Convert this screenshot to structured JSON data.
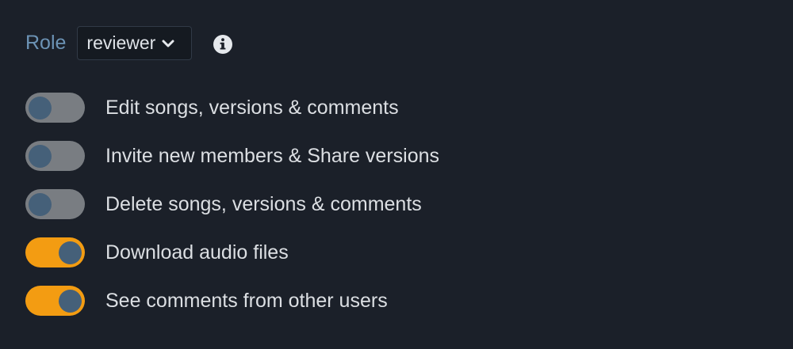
{
  "role": {
    "label": "Role",
    "selected": "reviewer"
  },
  "icons": {
    "info": "info-icon",
    "chevron": "chevron-down-icon"
  },
  "colors": {
    "background": "#1b2029",
    "accent_on": "#f39c12",
    "toggle_off": "#797d82",
    "knob": "#456079",
    "role_label": "#6c93b5"
  },
  "permissions": [
    {
      "label": "Edit songs, versions & comments",
      "enabled": false
    },
    {
      "label": "Invite new members & Share versions",
      "enabled": false
    },
    {
      "label": "Delete songs, versions & comments",
      "enabled": false
    },
    {
      "label": "Download audio files",
      "enabled": true
    },
    {
      "label": "See comments from other users",
      "enabled": true
    }
  ]
}
